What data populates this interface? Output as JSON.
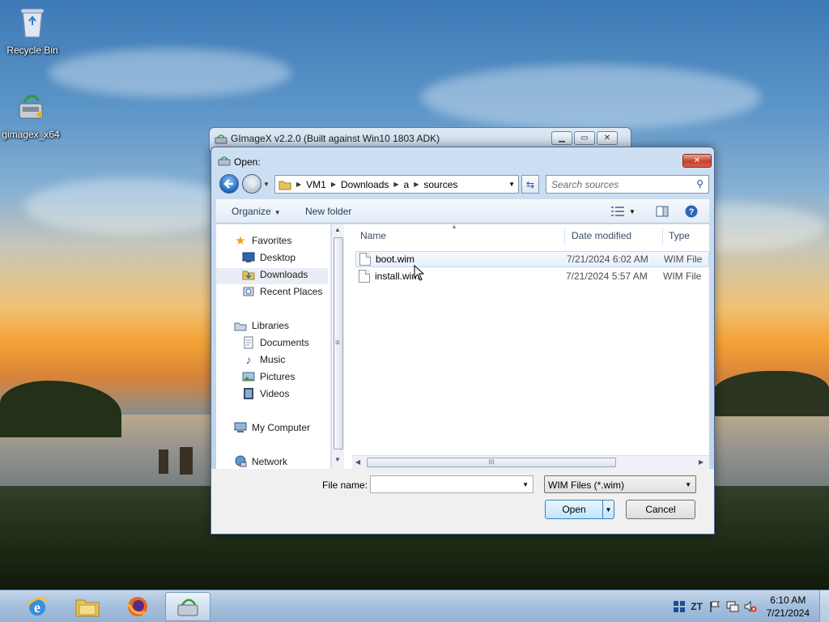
{
  "desktop": {
    "icons": [
      {
        "label": "Recycle Bin",
        "icon": "recycle-bin-icon"
      },
      {
        "label": "gimagex_x64",
        "icon": "gimagex-app-icon"
      }
    ]
  },
  "background_window": {
    "title": "GImageX v2.2.0 (Built against Win10 1803 ADK)"
  },
  "dialog": {
    "title": "Open:",
    "address": [
      "VM1",
      "Downloads",
      "a",
      "sources"
    ],
    "search_placeholder": "Search sources",
    "toolbar": {
      "organize": "Organize",
      "new_folder": "New folder"
    },
    "nav_pane": {
      "favorites": "Favorites",
      "favorites_items": [
        "Desktop",
        "Downloads",
        "Recent Places"
      ],
      "libraries": "Libraries",
      "libraries_items": [
        "Documents",
        "Music",
        "Pictures",
        "Videos"
      ],
      "my_computer": "My Computer",
      "network": "Network"
    },
    "columns": {
      "name": "Name",
      "date": "Date modified",
      "type": "Type"
    },
    "files": [
      {
        "name": "boot.wim",
        "date": "7/21/2024 6:02 AM",
        "type": "WIM File"
      },
      {
        "name": "install.wim",
        "date": "7/21/2024 5:57 AM",
        "type": "WIM File"
      }
    ],
    "file_name_label": "File name:",
    "file_name_value": "",
    "file_type": "WIM Files (*.wim)",
    "open_label": "Open",
    "cancel_label": "Cancel",
    "scroll_grip": "III",
    "scroll_grip_v": "≡"
  },
  "taskbar": {
    "time": "6:10 AM",
    "date": "7/21/2024",
    "ime": "ZT"
  },
  "colors": {
    "accent": "#1d66c0",
    "taskbar": "#a7c1dd"
  }
}
